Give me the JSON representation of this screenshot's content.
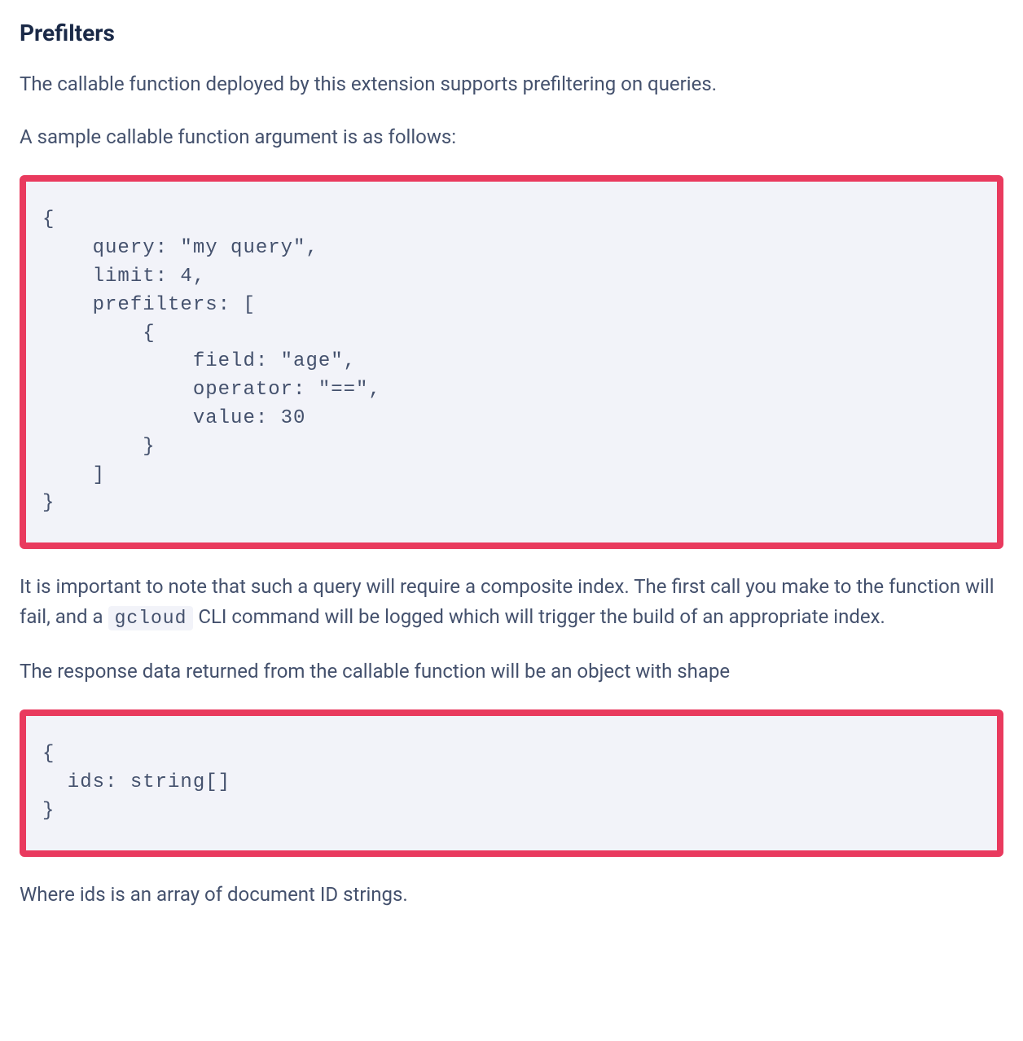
{
  "heading": "Prefilters",
  "para1": "The callable function deployed by this extension supports prefiltering on queries.",
  "para2": "A sample callable function argument is as follows:",
  "codeBlock1": "{\n    query: \"my query\",\n    limit: 4,\n    prefilters: [\n        {\n            field: \"age\",\n            operator: \"==\",\n            value: 30\n        }\n    ]\n}",
  "para3_part1": "It is important to note that such a query will require a composite index. The first call you make to the function will fail, and a ",
  "para3_inlineCode": "gcloud",
  "para3_part2": " CLI command will be logged which will trigger the build of an appropriate index.",
  "para4": "The response data returned from the callable function will be an object with shape",
  "codeBlock2": "{\n  ids: string[]\n}",
  "para5": "Where ids is an array of document ID strings."
}
